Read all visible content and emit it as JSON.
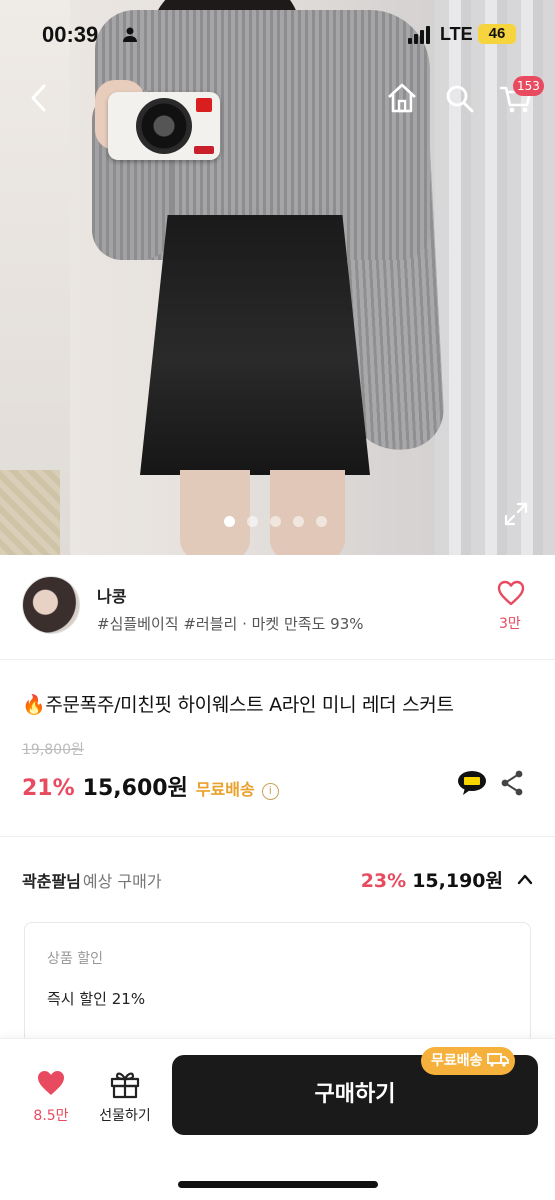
{
  "status_bar": {
    "time": "00:39",
    "network": "LTE",
    "battery": "46"
  },
  "header": {
    "cart_count": "153"
  },
  "gallery": {
    "total_images": 5,
    "active_index": 0
  },
  "seller": {
    "name": "나콩",
    "tags": "#심플베이직 #러블리 · 마켓 만족도 93%",
    "likes": "3만"
  },
  "product": {
    "title": "주문폭주/미친핏 하이웨스트 A라인 미니 레더 스커트",
    "original_price": "19,800원",
    "discount_rate": "21%",
    "price": "15,600원",
    "shipping": "무료배송"
  },
  "expected": {
    "user": "곽춘팔님",
    "label": "예상 구매가",
    "rate": "23%",
    "price": "15,190원"
  },
  "discounts": {
    "caption": "상품 할인",
    "items": [
      "즉시 할인 21%"
    ]
  },
  "bottom_bar": {
    "likes": "8.5만",
    "gift_label": "선물하기",
    "buy_label": "구매하기",
    "free_tag": "무료배송"
  },
  "colors": {
    "accent": "#e84b60",
    "shipping": "#e9a12b",
    "buy_button": "#1a1a1a"
  }
}
